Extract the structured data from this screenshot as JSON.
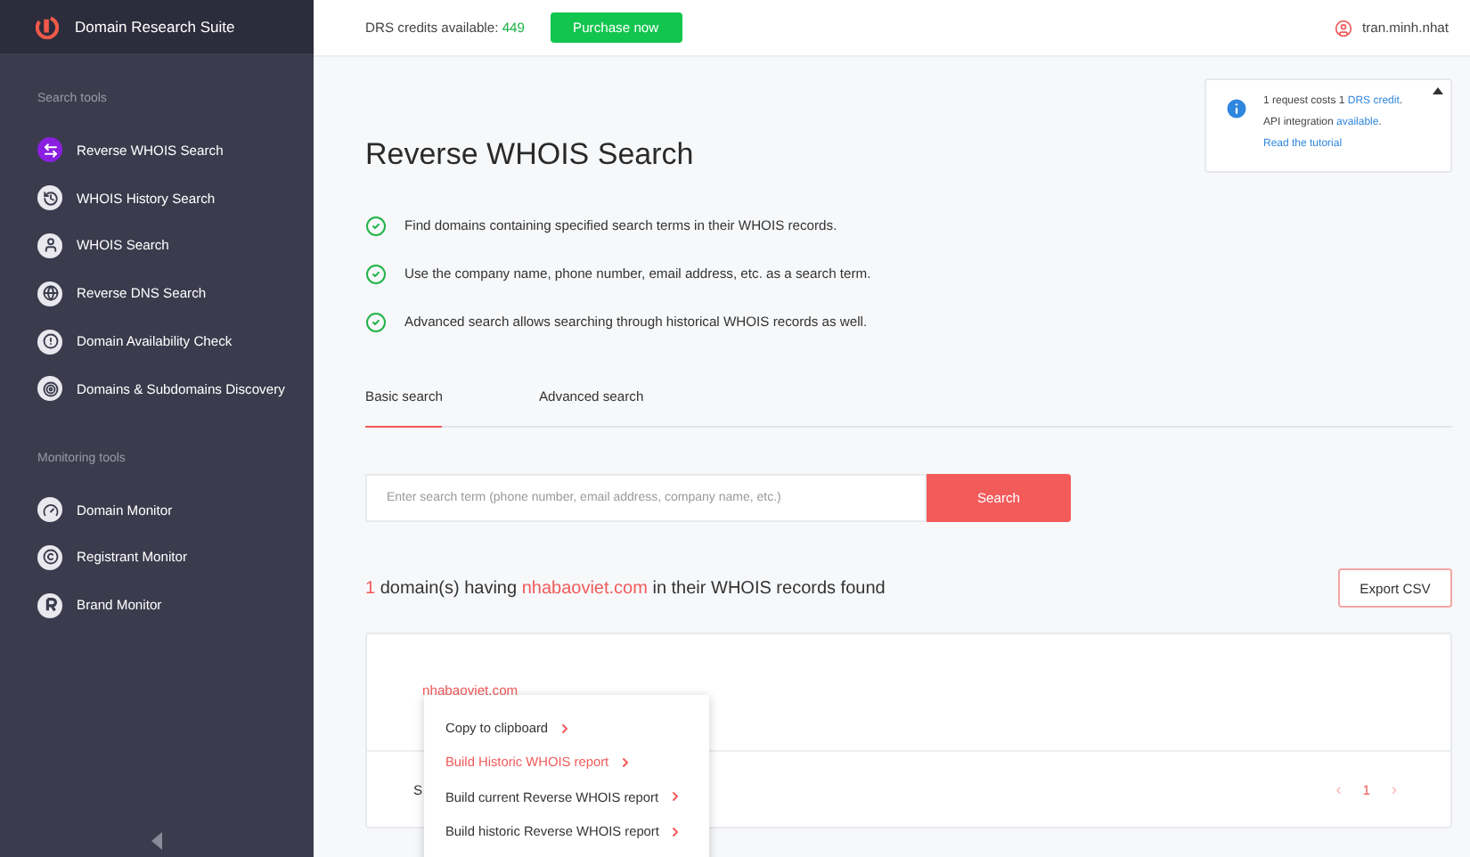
{
  "brand": {
    "name": "Domain Research Suite"
  },
  "sidebar": {
    "sections": [
      {
        "heading": "Search tools",
        "items": [
          {
            "label": "Reverse WHOIS Search",
            "selected": true
          },
          {
            "label": "WHOIS History Search",
            "selected": false
          },
          {
            "label": "WHOIS Search",
            "selected": false
          },
          {
            "label": "Reverse DNS Search",
            "selected": false
          },
          {
            "label": "Domain Availability Check",
            "selected": false
          },
          {
            "label": "Domains & Subdomains Discovery",
            "selected": false
          }
        ]
      },
      {
        "heading": "Monitoring tools",
        "items": [
          {
            "label": "Domain Monitor",
            "selected": false
          },
          {
            "label": "Registrant Monitor",
            "selected": false
          },
          {
            "label": "Brand Monitor",
            "selected": false
          }
        ]
      }
    ]
  },
  "header": {
    "credits_label": "DRS credits available:",
    "credits_value": "449",
    "purchase_button": "Purchase now",
    "user": "tran.minh.nhat"
  },
  "info_box": {
    "lines": [
      {
        "before": "1 request costs 1 ",
        "link": "DRS credit",
        "after": "."
      },
      {
        "before": "API integration ",
        "link": "available",
        "after": "."
      },
      {
        "link": "Read the tutorial"
      }
    ]
  },
  "page": {
    "title": "Reverse WHOIS Search",
    "features": [
      "Find domains containing specified search terms in their WHOIS records.",
      "Use the company name, phone number, email address, etc. as a search term.",
      "Advanced search allows searching through historical WHOIS records as well."
    ],
    "tabs": [
      {
        "label": "Basic search",
        "selected": true
      },
      {
        "label": "Advanced search",
        "selected": false
      }
    ],
    "search": {
      "placeholder": "Enter search term (phone number, email address, company name, etc.)",
      "button": "Search"
    },
    "result_heading": {
      "count": "1",
      "middle": " domain(s) having ",
      "term": "nhabaoviet.com",
      "end": " in their WHOIS records found"
    },
    "export_button": "Export CSV",
    "results": {
      "domains": [
        "nhabaoviet.com"
      ],
      "footer_text": "S",
      "pagination": {
        "prev": "‹",
        "pages": [
          {
            "label": "1",
            "selected": true
          }
        ],
        "next": "›"
      }
    },
    "context_menu": [
      {
        "label": "Copy to clipboard",
        "selected": false
      },
      {
        "label": "Build Historic WHOIS report",
        "selected": true
      },
      {
        "label": "Build current Reverse WHOIS report",
        "selected": false
      },
      {
        "label": "Build historic Reverse WHOIS report",
        "selected": false
      }
    ]
  }
}
